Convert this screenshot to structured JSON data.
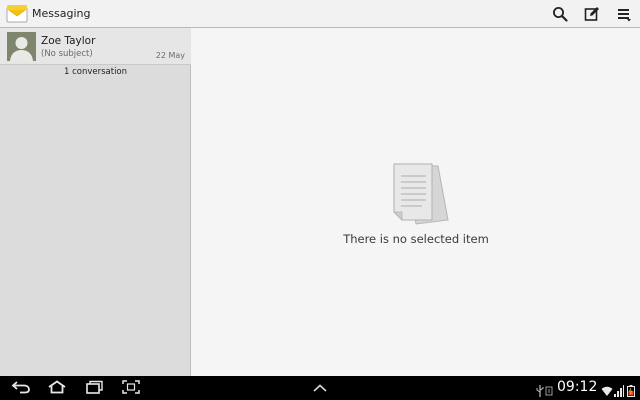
{
  "app": {
    "title": "Messaging"
  },
  "conversations": [
    {
      "name": "Zoe Taylor",
      "subject": "(No subject)",
      "date": "22 May"
    }
  ],
  "conversation_count": "1 conversation",
  "detail": {
    "empty_message": "There is no selected item"
  },
  "status_bar": {
    "time": "09:12"
  },
  "icons": {
    "app": "envelope-icon",
    "search": "search-icon",
    "compose": "compose-icon",
    "menu": "menu-icon",
    "back": "back-icon",
    "home": "home-icon",
    "recent": "recent-apps-icon",
    "screenshot": "screenshot-icon",
    "up": "chevron-up-icon",
    "usb": "usb-icon",
    "battery": "battery-icon"
  },
  "colors": {
    "accent": "#f4c20d",
    "nav_bar": "#000000",
    "action_bar": "#f2f2f2"
  }
}
